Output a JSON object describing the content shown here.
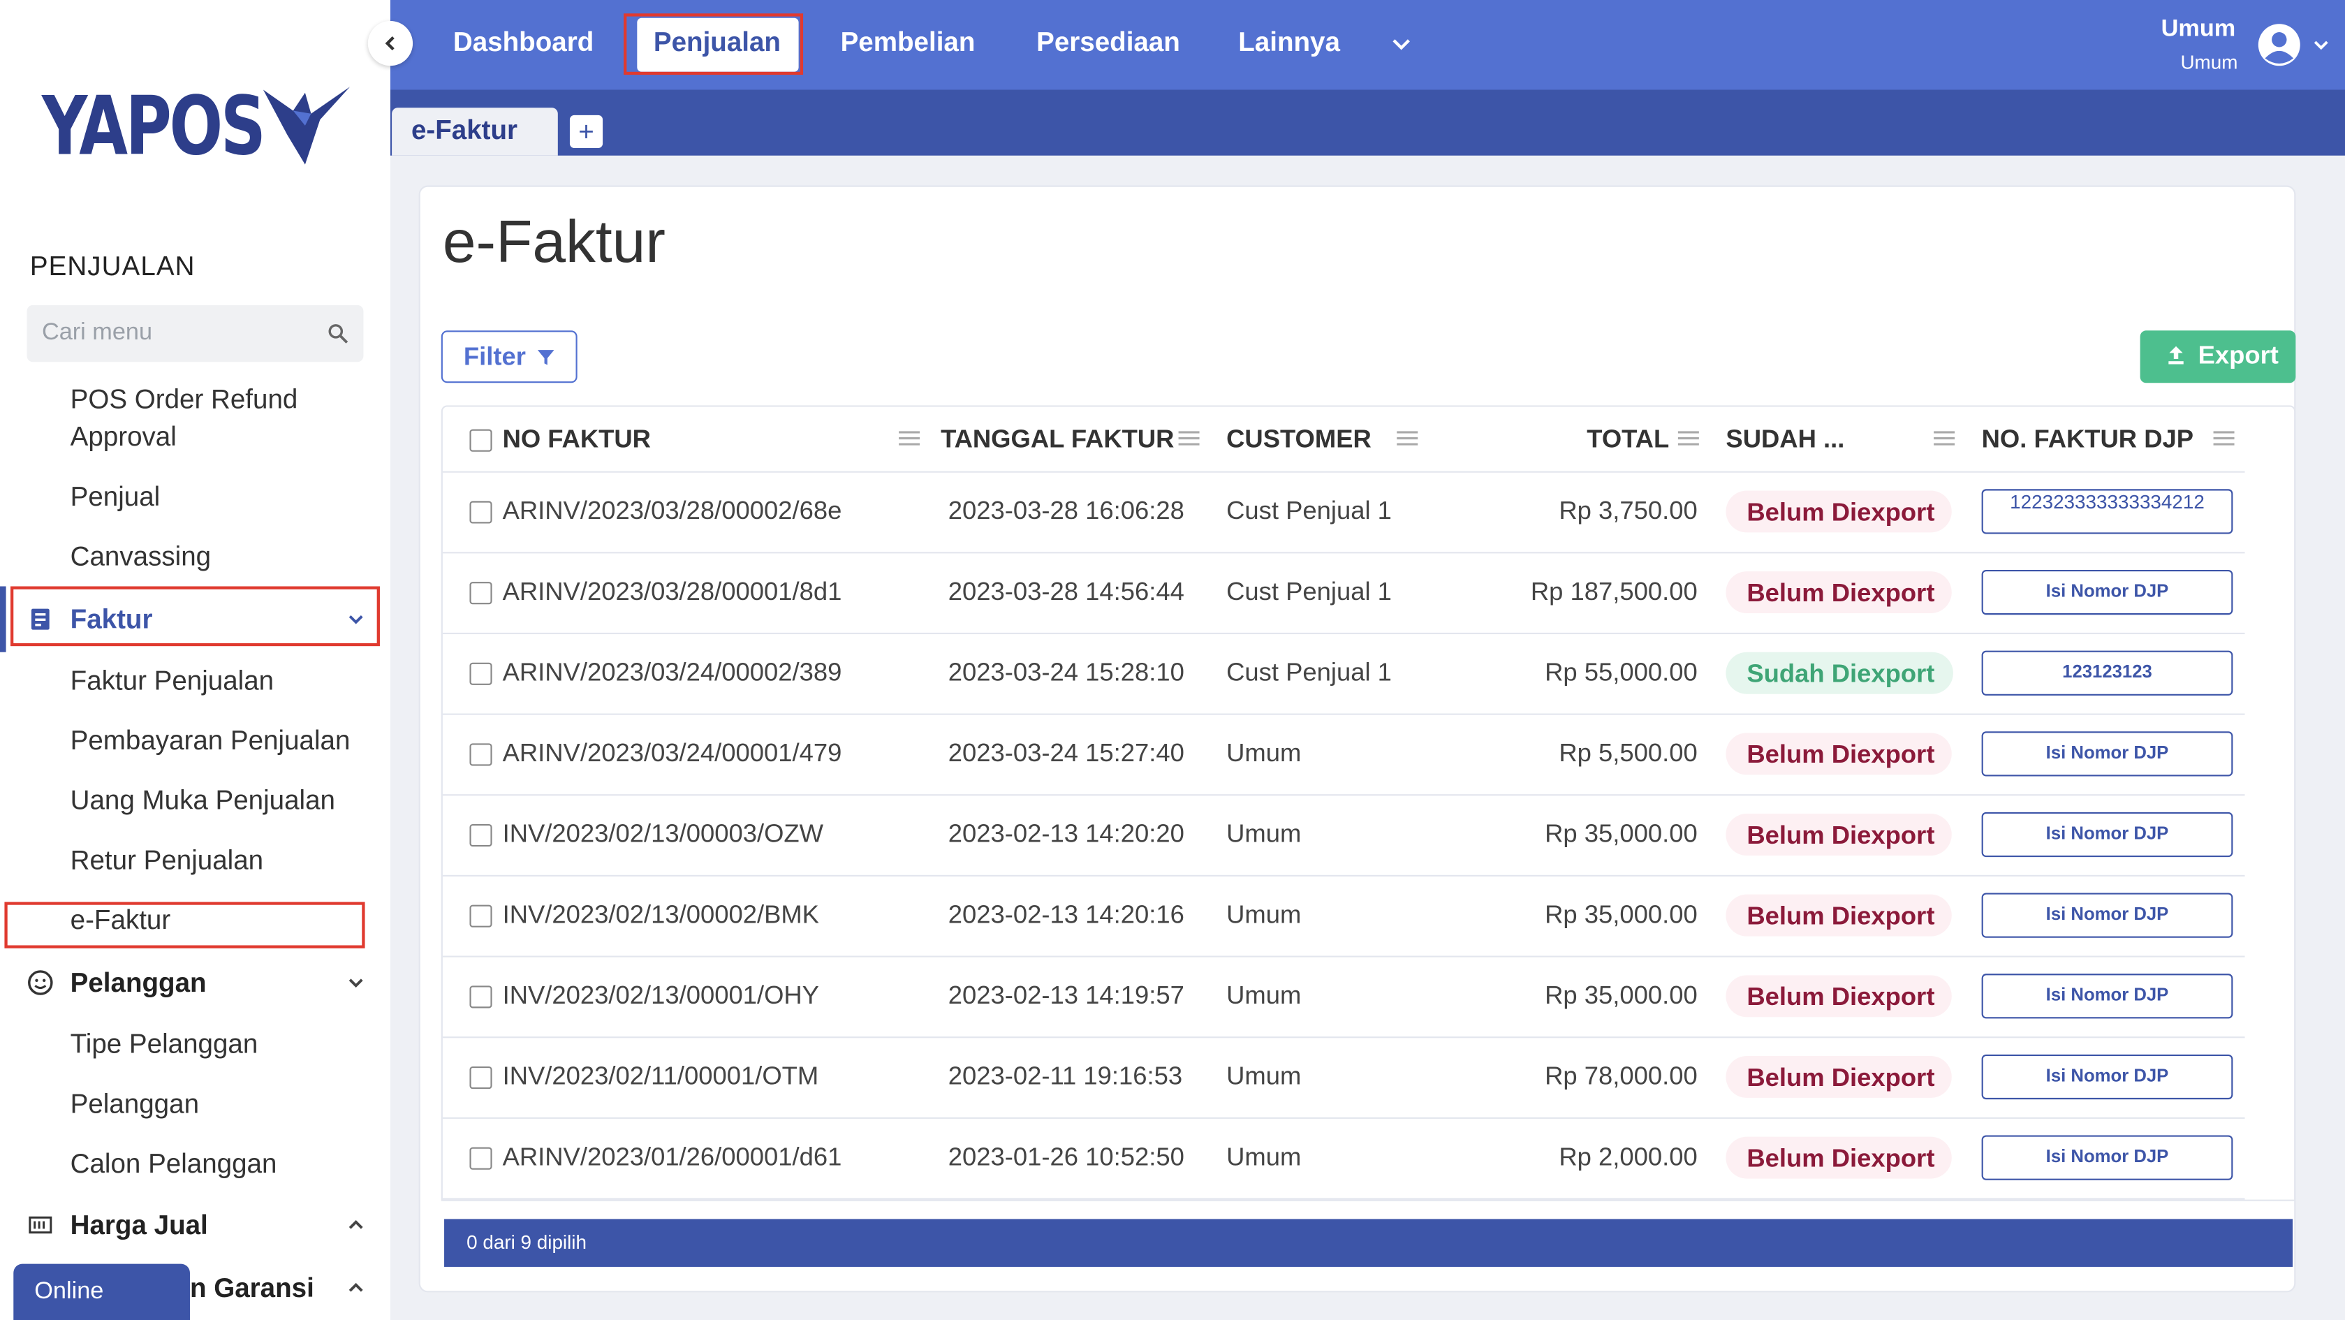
{
  "app": {
    "logo_text": "YAPOS"
  },
  "sidebar": {
    "section_title": "PENJUALAN",
    "search_placeholder": "Cari menu",
    "items_top": [
      {
        "label": "POS Order Refund Approval"
      },
      {
        "label": "Penjual"
      },
      {
        "label": "Canvassing"
      }
    ],
    "group_faktur": {
      "label": "Faktur",
      "children": [
        {
          "label": "Faktur Penjualan"
        },
        {
          "label": "Pembayaran Penjualan"
        },
        {
          "label": "Uang Muka Penjualan"
        },
        {
          "label": "Retur Penjualan"
        },
        {
          "label": "e-Faktur"
        }
      ]
    },
    "group_pelanggan": {
      "label": "Pelanggan",
      "children": [
        {
          "label": "Tipe Pelanggan"
        },
        {
          "label": "Pelanggan"
        },
        {
          "label": "Calon Pelanggan"
        }
      ]
    },
    "group_harga": {
      "label": "Harga Jual"
    },
    "group_garansi": {
      "label": "n Garansi"
    },
    "online_label": "Online"
  },
  "topnav": {
    "items": [
      "Dashboard",
      "Penjualan",
      "Pembelian",
      "Persediaan",
      "Lainnya"
    ],
    "active": "Penjualan",
    "user_name": "Umum",
    "user_role": "Umum"
  },
  "tabs": {
    "items": [
      "e-Faktur"
    ],
    "add_label": "+"
  },
  "page": {
    "title": "e-Faktur",
    "filter_label": "Filter",
    "export_label": "Export"
  },
  "table": {
    "columns": [
      "NO FAKTUR",
      "TANGGAL FAKTUR",
      "CUSTOMER",
      "TOTAL",
      "SUDAH ...",
      "NO. FAKTUR DJP"
    ],
    "rows": [
      {
        "no": "ARINV/2023/03/28/00002/68e",
        "date": "2023-03-28 16:06:28",
        "customer": "Cust Penjual 1",
        "total": "Rp 3,750.00",
        "status": "Belum Diexport",
        "djp": "122323333333334212"
      },
      {
        "no": "ARINV/2023/03/28/00001/8d1",
        "date": "2023-03-28 14:56:44",
        "customer": "Cust Penjual 1",
        "total": "Rp 187,500.00",
        "status": "Belum Diexport",
        "djp": "Isi Nomor DJP"
      },
      {
        "no": "ARINV/2023/03/24/00002/389",
        "date": "2023-03-24 15:28:10",
        "customer": "Cust Penjual 1",
        "total": "Rp 55,000.00",
        "status": "Sudah Diexport",
        "djp": "123123123"
      },
      {
        "no": "ARINV/2023/03/24/00001/479",
        "date": "2023-03-24 15:27:40",
        "customer": "Umum",
        "total": "Rp 5,500.00",
        "status": "Belum Diexport",
        "djp": "Isi Nomor DJP"
      },
      {
        "no": "INV/2023/02/13/00003/OZW",
        "date": "2023-02-13 14:20:20",
        "customer": "Umum",
        "total": "Rp 35,000.00",
        "status": "Belum Diexport",
        "djp": "Isi Nomor DJP"
      },
      {
        "no": "INV/2023/02/13/00002/BMK",
        "date": "2023-02-13 14:20:16",
        "customer": "Umum",
        "total": "Rp 35,000.00",
        "status": "Belum Diexport",
        "djp": "Isi Nomor DJP"
      },
      {
        "no": "INV/2023/02/13/00001/OHY",
        "date": "2023-02-13 14:19:57",
        "customer": "Umum",
        "total": "Rp 35,000.00",
        "status": "Belum Diexport",
        "djp": "Isi Nomor DJP"
      },
      {
        "no": "INV/2023/02/11/00001/OTM",
        "date": "2023-02-11 19:16:53",
        "customer": "Umum",
        "total": "Rp 78,000.00",
        "status": "Belum Diexport",
        "djp": "Isi Nomor DJP"
      },
      {
        "no": "ARINV/2023/01/26/00001/d61",
        "date": "2023-01-26 10:52:50",
        "customer": "Umum",
        "total": "Rp 2,000.00",
        "status": "Belum Diexport",
        "djp": "Isi Nomor DJP"
      }
    ],
    "footer": "0 dari 9 dipilih"
  },
  "colors": {
    "nav_blue": "#5371d1",
    "dark_blue": "#3d55a8",
    "export_green": "#4dbf8e",
    "highlight_red": "#e03a2f"
  }
}
